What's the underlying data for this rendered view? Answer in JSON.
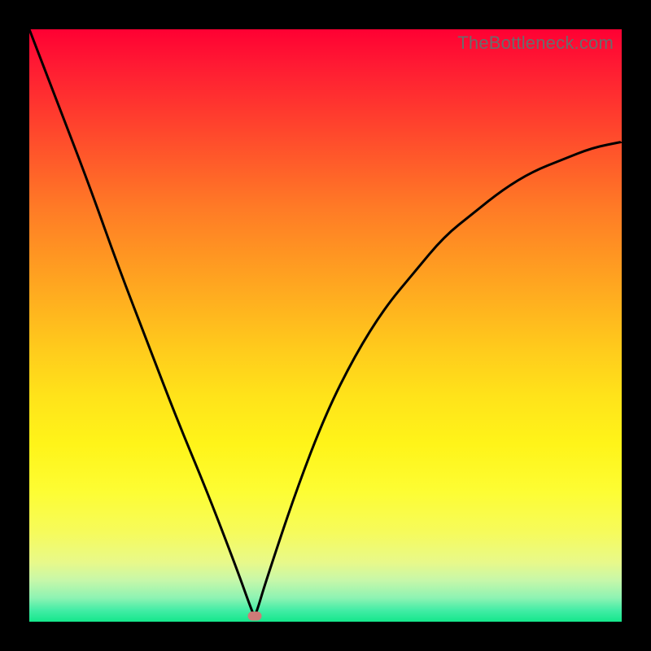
{
  "attribution": "TheBottleneck.com",
  "colors": {
    "frame": "#000000",
    "curve": "#000000",
    "dot": "#cf7b78",
    "attribution": "#6b6b6b"
  },
  "chart_data": {
    "type": "line",
    "title": "",
    "xlabel": "",
    "ylabel": "",
    "xlim": [
      0,
      1
    ],
    "ylim": [
      0,
      1
    ],
    "grid": false,
    "legend": false,
    "notes": "Axes are not labeled in the source image; x and y normalized 0–1. y=0 corresponds to the green bottom band, y=1 to the red top. Single black V-shaped curve with minimum near x≈0.38. A small pink oval marker sits at the curve minimum.",
    "series": [
      {
        "name": "curve",
        "x": [
          0.0,
          0.05,
          0.1,
          0.15,
          0.2,
          0.25,
          0.3,
          0.35,
          0.375,
          0.38,
          0.385,
          0.4,
          0.45,
          0.5,
          0.55,
          0.6,
          0.65,
          0.7,
          0.75,
          0.8,
          0.85,
          0.9,
          0.95,
          1.0
        ],
        "values": [
          1.0,
          0.87,
          0.74,
          0.6,
          0.47,
          0.34,
          0.22,
          0.09,
          0.02,
          0.01,
          0.02,
          0.07,
          0.22,
          0.35,
          0.45,
          0.53,
          0.59,
          0.65,
          0.69,
          0.73,
          0.76,
          0.78,
          0.8,
          0.81
        ]
      }
    ],
    "marker": {
      "x": 0.38,
      "y": 0.01
    }
  }
}
